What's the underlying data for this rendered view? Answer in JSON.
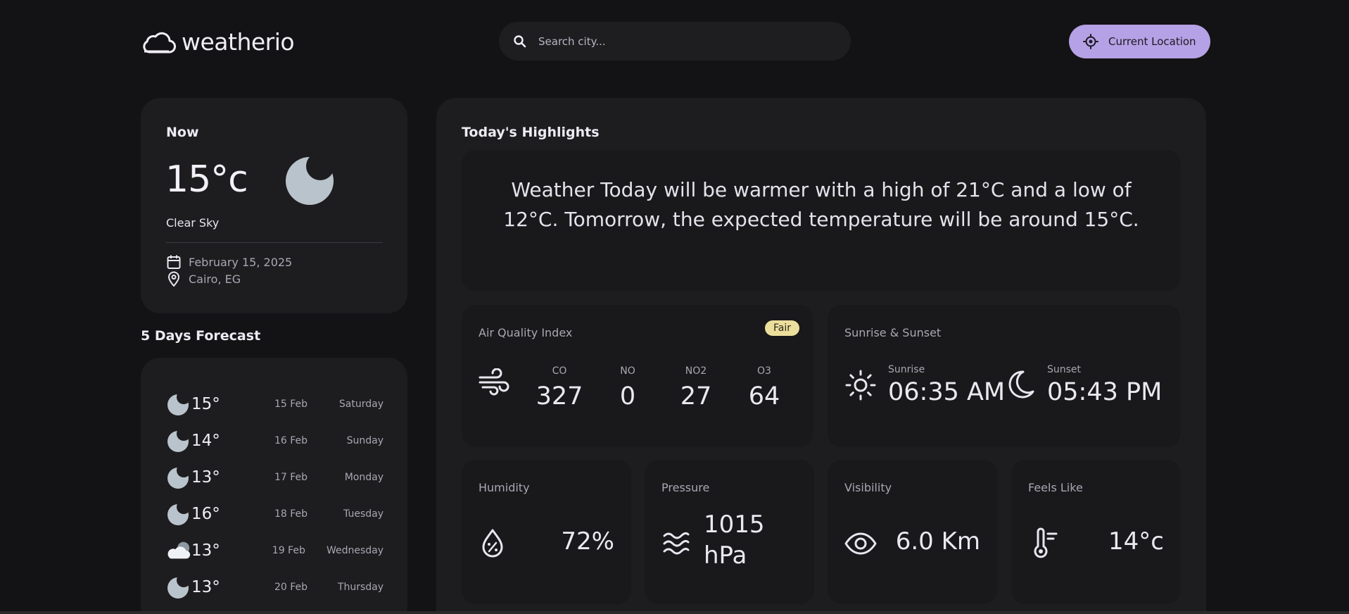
{
  "header": {
    "logo_text": "weatherio",
    "search_placeholder": "Search city...",
    "location_button": "Current Location"
  },
  "now": {
    "label": "Now",
    "temperature": "15°c",
    "condition": "Clear Sky",
    "condition_icon": "moon-icon",
    "date": "February 15, 2025",
    "location": "Cairo, EG"
  },
  "forecast": {
    "title": "5 Days Forecast",
    "items": [
      {
        "icon": "moon-icon",
        "temp": "15°",
        "date": "15 Feb",
        "day": "Saturday"
      },
      {
        "icon": "moon-icon",
        "temp": "14°",
        "date": "16 Feb",
        "day": "Sunday"
      },
      {
        "icon": "moon-icon",
        "temp": "13°",
        "date": "17 Feb",
        "day": "Monday"
      },
      {
        "icon": "moon-icon",
        "temp": "16°",
        "date": "18 Feb",
        "day": "Tuesday"
      },
      {
        "icon": "cloud-moon-icon",
        "temp": "13°",
        "date": "19 Feb",
        "day": "Wednesday"
      },
      {
        "icon": "moon-icon",
        "temp": "13°",
        "date": "20 Feb",
        "day": "Thursday"
      }
    ]
  },
  "highlights": {
    "title": "Today's Highlights",
    "summary": "Weather Today will be warmer with a high of 21°C and a low of 12°C. Tomorrow, the expected temperature will be around 15°C.",
    "air_quality": {
      "label": "Air Quality Index",
      "badge": "Fair",
      "badge_color": "#ecdf9c",
      "items": [
        {
          "key": "CO",
          "value": "327"
        },
        {
          "key": "NO",
          "value": "0"
        },
        {
          "key": "NO2",
          "value": "27"
        },
        {
          "key": "O3",
          "value": "64"
        }
      ]
    },
    "sun": {
      "label": "Sunrise & Sunset",
      "sunrise_label": "Sunrise",
      "sunrise": "06:35 AM",
      "sunset_label": "Sunset",
      "sunset": "05:43 PM"
    },
    "humidity": {
      "label": "Humidity",
      "value": "72%"
    },
    "pressure": {
      "label": "Pressure",
      "value_line1": "1015",
      "value_line2": "hPa"
    },
    "visibility": {
      "label": "Visibility",
      "value": "6.0 Km"
    },
    "feels_like": {
      "label": "Feels Like",
      "value": "14°c"
    }
  },
  "colors": {
    "background": "#131214",
    "card": "#1d1c1f",
    "accent": "#b5a1e5"
  }
}
